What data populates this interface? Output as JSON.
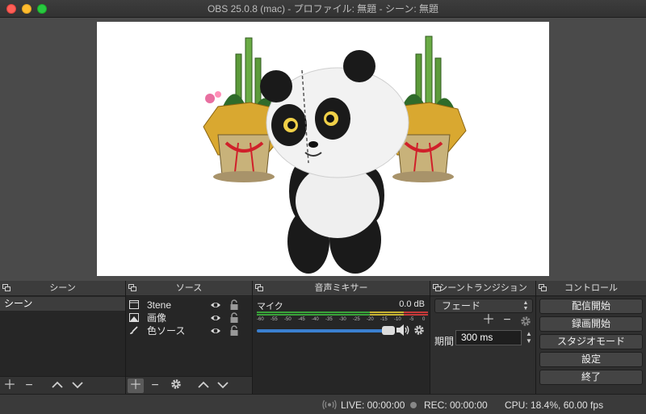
{
  "window": {
    "title": "OBS 25.0.8 (mac) - プロファイル: 無題 - シーン: 無題"
  },
  "docks": {
    "scenes": {
      "title": "シーン",
      "items": [
        "シーン"
      ]
    },
    "sources": {
      "title": "ソース",
      "items": [
        {
          "label": "3tene",
          "icon": "window-capture-icon"
        },
        {
          "label": "画像",
          "icon": "image-icon"
        },
        {
          "label": "色ソース",
          "icon": "paintbrush-icon"
        }
      ]
    },
    "mixer": {
      "title": "音声ミキサー",
      "channel": "マイク",
      "level": "0.0 dB",
      "scale": [
        "-60",
        "-55",
        "-50",
        "-45",
        "-40",
        "-35",
        "-30",
        "-25",
        "-20",
        "-15",
        "-10",
        "-5",
        "0"
      ],
      "volume_fraction": 0.96
    },
    "transitions": {
      "title": "シーントランジション",
      "selected": "フェード",
      "duration_label": "期間",
      "duration_value": "300 ms"
    },
    "controls": {
      "title": "コントロール",
      "buttons": [
        "配信開始",
        "録画開始",
        "スタジオモード",
        "設定",
        "終了"
      ]
    }
  },
  "status": {
    "live": "LIVE: 00:00:00",
    "rec": "REC: 00:00:00",
    "cpu": "CPU: 18.4%, 60.00 fps"
  },
  "colors": {
    "accent": "#3a7fd0",
    "meter_green": "#3aa53a",
    "meter_yellow": "#c8b433",
    "meter_red": "#c83a3a"
  }
}
